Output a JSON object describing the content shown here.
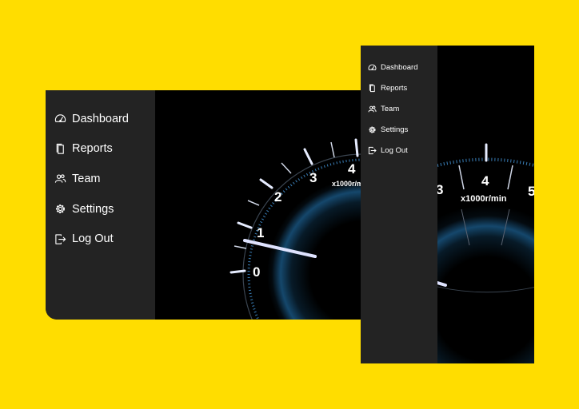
{
  "nav": {
    "items": [
      {
        "label": "Dashboard",
        "icon": "dashboard-gauge-icon"
      },
      {
        "label": "Reports",
        "icon": "document-icon"
      },
      {
        "label": "Team",
        "icon": "users-icon"
      },
      {
        "label": "Settings",
        "icon": "gear-icon"
      },
      {
        "label": "Log Out",
        "icon": "logout-icon"
      }
    ]
  },
  "gauge": {
    "unit_label": "x1000r/min",
    "ticks": [
      "0",
      "1",
      "2",
      "3",
      "4",
      "5"
    ]
  },
  "colors": {
    "page_background": "#FFDD00",
    "sidebar": "#232323",
    "screen": "#000000",
    "gauge_accent": "#2a8fd8"
  }
}
